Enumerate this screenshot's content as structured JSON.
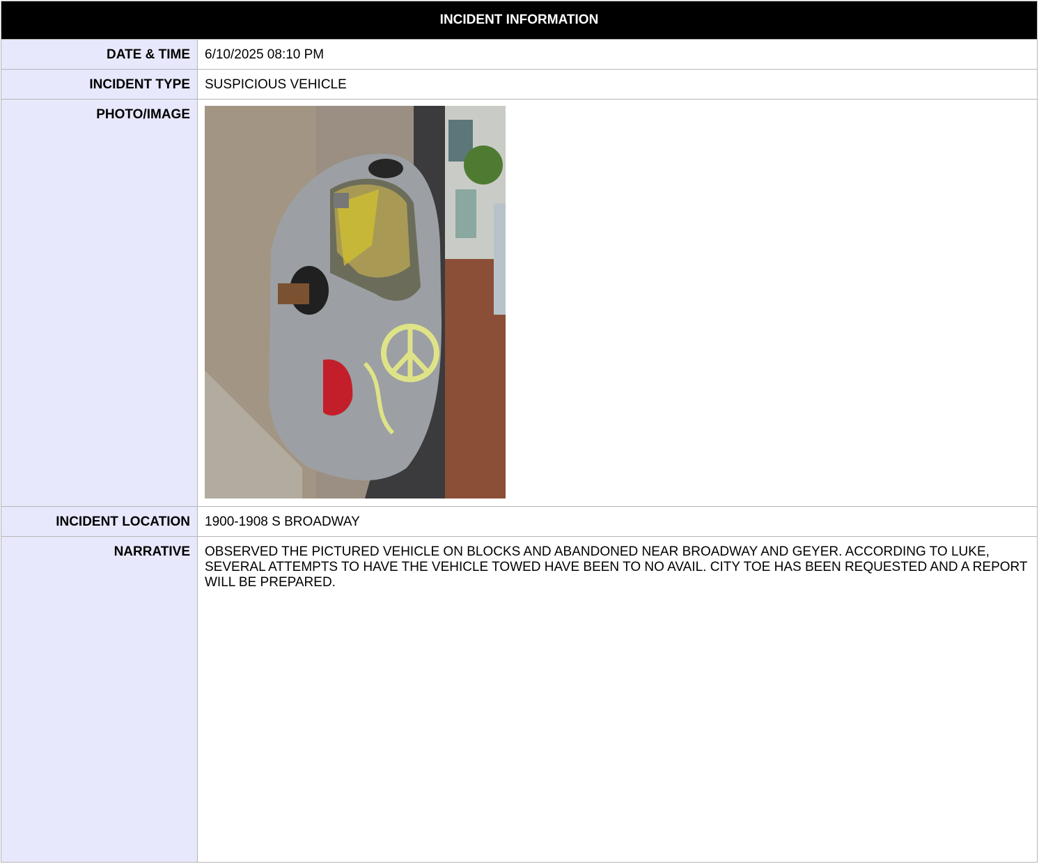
{
  "header": {
    "title": "INCIDENT INFORMATION"
  },
  "fields": {
    "date_time": {
      "label": "DATE & TIME",
      "value": "6/10/2025 08:10 PM"
    },
    "incident_type": {
      "label": "INCIDENT TYPE",
      "value": "SUSPICIOUS VEHICLE"
    },
    "photo": {
      "label": "PHOTO/IMAGE"
    },
    "location": {
      "label": "INCIDENT LOCATION",
      "value": "1900-1908 S BROADWAY"
    },
    "narrative": {
      "label": "NARRATIVE",
      "value": "OBSERVED THE PICTURED VEHICLE ON BLOCKS AND ABANDONED NEAR BROADWAY AND GEYER. ACCORDING TO LUKE, SEVERAL ATTEMPTS TO HAVE THE VEHICLE TOWED HAVE BEEN TO NO AVAIL. CITY TOE HAS BEEN REQUESTED AND A REPORT WILL BE PREPARED."
    }
  }
}
